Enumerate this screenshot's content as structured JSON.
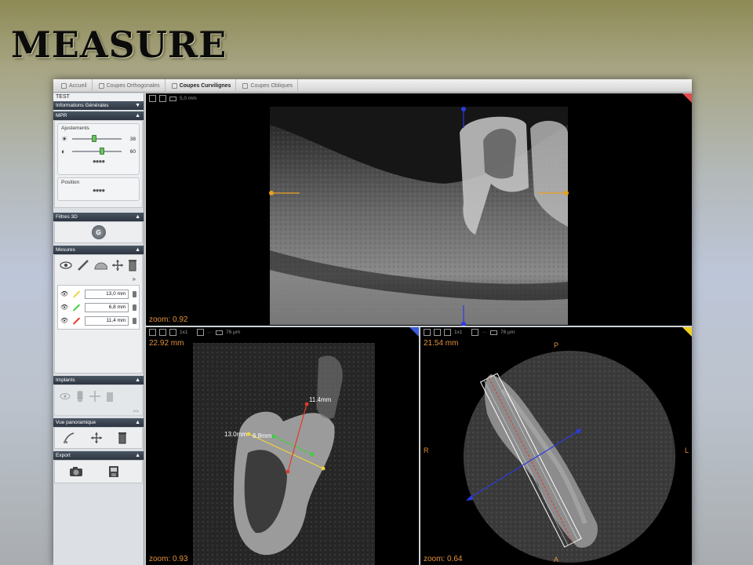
{
  "slide": {
    "title": "MEASURE"
  },
  "tabs": [
    {
      "label": "Accueil",
      "active": false
    },
    {
      "label": "Coupes Orthogonales",
      "active": false
    },
    {
      "label": "Coupes Curvilignes",
      "active": true
    },
    {
      "label": "Coupes Obliques",
      "active": false
    }
  ],
  "sidebar": {
    "case_name": "TEST",
    "info_header": "Informations Générales",
    "mpr": {
      "header": "MPR",
      "adjust_label": "Ajustements",
      "brightness_value": "38",
      "brightness_level": 0.45,
      "contrast_value": "60",
      "contrast_level": 0.6,
      "position_label": "Position"
    },
    "filters": {
      "header": "Filtres 3D",
      "button": "G"
    },
    "measures": {
      "header": "Mesures",
      "items": [
        {
          "value": "13,0 mm",
          "color": "#f2d43a"
        },
        {
          "value": "6,8 mm",
          "color": "#3fcf3f"
        },
        {
          "value": "11,4 mm",
          "color": "#e23b2a"
        }
      ]
    },
    "implants": {
      "header": "Implants",
      "more": ">>"
    },
    "panoramic": {
      "header": "Vue panoramique"
    },
    "export": {
      "header": "Export"
    }
  },
  "views": {
    "top": {
      "scale": "5,0 mm",
      "zoom": "zoom: 0.92",
      "corner_color": "#e24a4a"
    },
    "bottom_left": {
      "mode": "1x1",
      "res": "76 µm",
      "size": "22.92 mm",
      "zoom": "zoom: 0.93",
      "corner_color": "#3b5bd9",
      "labels": {
        "m1": "13.0mm",
        "m2": "6.8mm",
        "m3": "11.4mm"
      }
    },
    "bottom_right": {
      "mode": "1x1",
      "res": "76 µm",
      "size": "21.54 mm",
      "zoom": "zoom: 0.64",
      "corner_color": "#f0d020",
      "orient": {
        "top": "P",
        "bottom": "A",
        "left": "R",
        "right": "L"
      }
    }
  },
  "colors": {
    "accent_orange": "#e0923d",
    "guide_blue": "#2a3be0",
    "guide_orange": "#e8a020"
  }
}
